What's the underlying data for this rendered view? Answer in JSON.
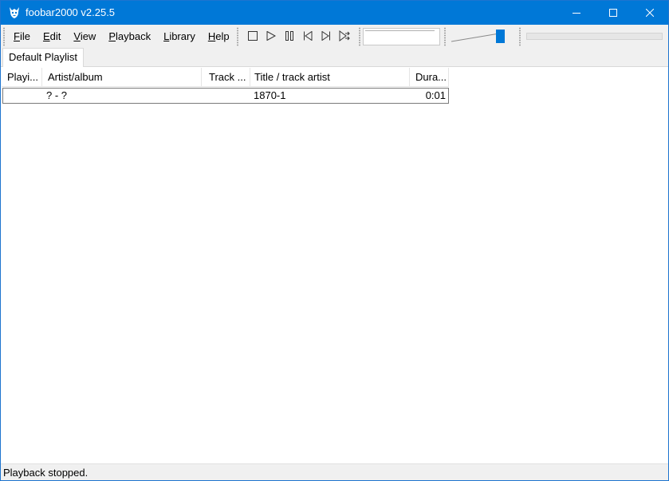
{
  "window": {
    "title": "foobar2000 v2.25.5",
    "app_icon": "foobar2000-icon",
    "controls": [
      "minimize-icon",
      "maximize-icon",
      "close-icon"
    ]
  },
  "menu": {
    "items": [
      "File",
      "Edit",
      "View",
      "Playback",
      "Library",
      "Help"
    ]
  },
  "transport": {
    "buttons": [
      "stop-icon",
      "play-icon",
      "pause-icon",
      "previous-icon",
      "next-icon",
      "random-icon"
    ]
  },
  "volume": {
    "level": 0.95
  },
  "tabs": [
    "Default Playlist"
  ],
  "playlist": {
    "columns": [
      "Playi...",
      "Artist/album",
      "Track ...",
      "Title / track artist",
      "Dura..."
    ],
    "rows": [
      {
        "playing": "",
        "artist_album": "? - ?",
        "track": "",
        "title": "1870-1",
        "duration": "0:01"
      }
    ]
  },
  "status": {
    "text": "Playback stopped."
  },
  "colors": {
    "accent": "#0078d7",
    "chrome": "#f0f0f0"
  }
}
